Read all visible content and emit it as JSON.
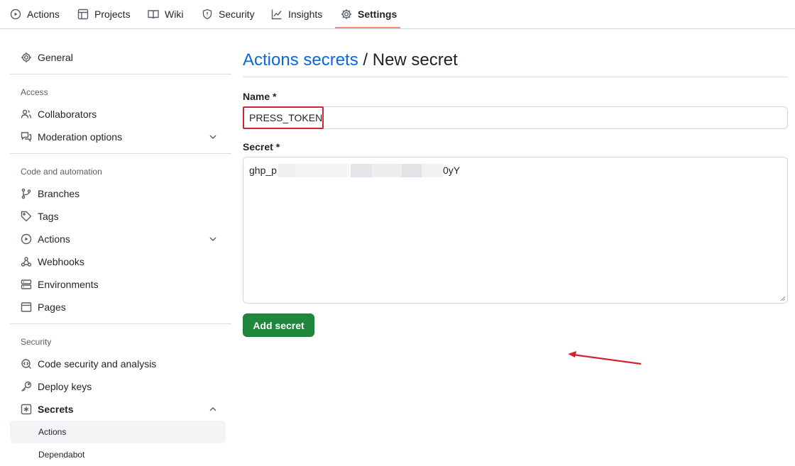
{
  "nav": {
    "tabs": [
      {
        "label": "Actions",
        "icon": "play-circle-icon"
      },
      {
        "label": "Projects",
        "icon": "table-icon"
      },
      {
        "label": "Wiki",
        "icon": "book-icon"
      },
      {
        "label": "Security",
        "icon": "shield-icon"
      },
      {
        "label": "Insights",
        "icon": "graph-icon"
      },
      {
        "label": "Settings",
        "icon": "gear-icon",
        "selected": true
      }
    ],
    "accent_color": "#fd8c73"
  },
  "sidebar": {
    "general": "General",
    "headings": {
      "access": "Access",
      "code_automation": "Code and automation",
      "security": "Security"
    },
    "access_items": [
      "Collaborators",
      "Moderation options"
    ],
    "code_items": [
      "Branches",
      "Tags",
      "Actions",
      "Webhooks",
      "Environments",
      "Pages"
    ],
    "security_items": [
      "Code security and analysis",
      "Deploy keys",
      "Secrets"
    ],
    "secrets_sub": [
      "Actions",
      "Dependabot"
    ],
    "active_color": "#0969da"
  },
  "main": {
    "breadcrumb_link": "Actions secrets",
    "breadcrumb_sep": " / ",
    "breadcrumb_current": "New secret",
    "name_label": "Name *",
    "name_value": "PRESS_TOKEN",
    "secret_label": "Secret *",
    "secret_prefix": "ghp_p",
    "secret_suffix": "0yY",
    "submit_label": "Add secret",
    "button_color": "#1f883d",
    "highlight_color": "#d1242f"
  }
}
